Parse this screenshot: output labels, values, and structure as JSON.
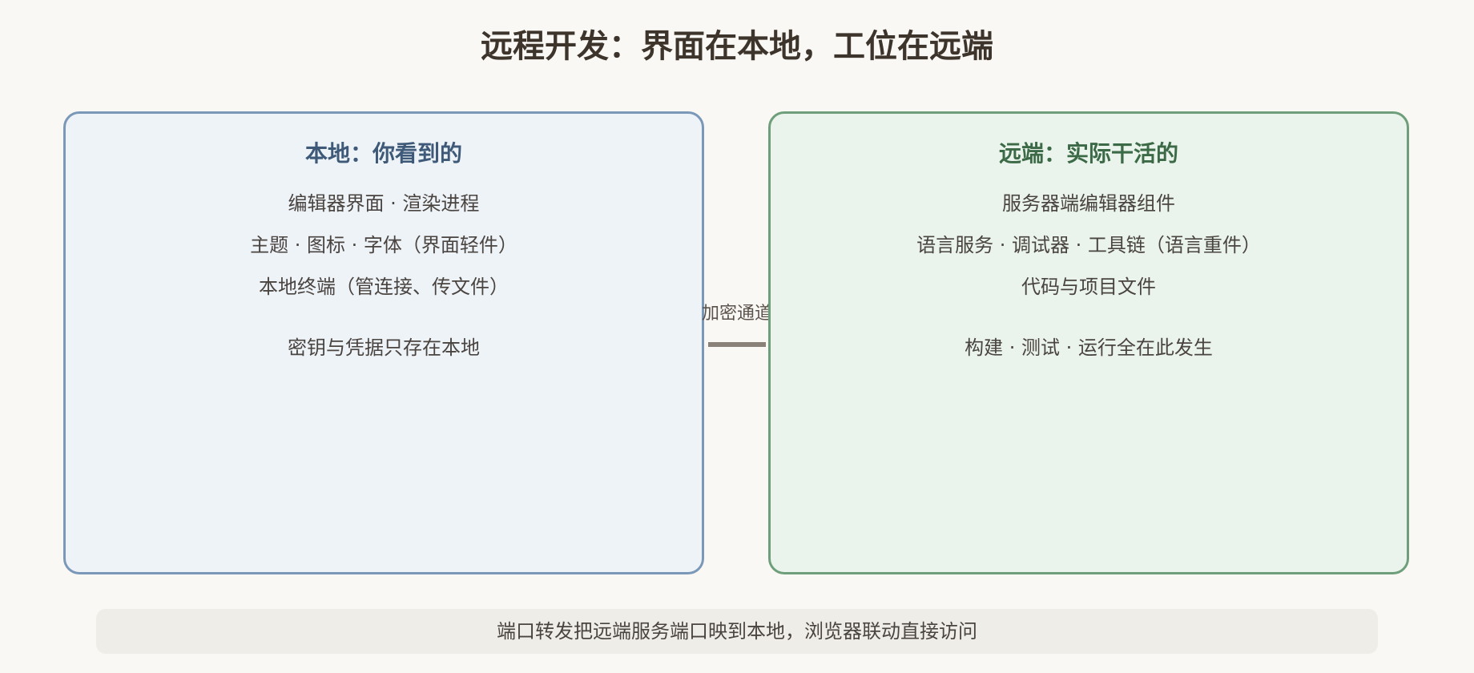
{
  "title": "远程开发：界面在本地，工位在远端",
  "local": {
    "heading": "本地：你看到的",
    "lines": [
      "编辑器界面 · 渲染进程",
      "主题 · 图标 · 字体（界面轻件）",
      "本地终端（管连接、传文件）",
      "密钥与凭据只存在本地"
    ]
  },
  "remote": {
    "heading": "远端：实际干活的",
    "lines": [
      "服务器端编辑器组件",
      "语言服务 · 调试器 · 工具链（语言重件）",
      "代码与项目文件",
      "构建 · 测试 · 运行全在此发生"
    ]
  },
  "connection": {
    "label": "加密通道"
  },
  "footer": {
    "text": "端口转发把远端服务端口映到本地，浏览器联动直接访问"
  },
  "colors": {
    "local_border": "#7b98b8",
    "local_fill": "#eef3f8",
    "remote_border": "#6f9f7a",
    "remote_fill": "#eaf4ec"
  }
}
